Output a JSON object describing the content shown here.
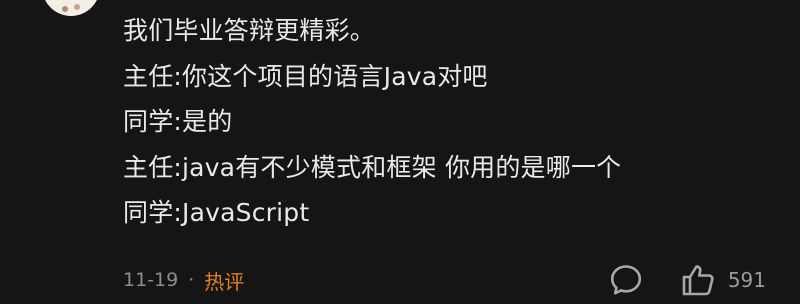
{
  "comment": {
    "lines": [
      "我们毕业答辩更精彩。",
      "主任:你这个项目的语言Java对吧",
      "同学:是的",
      "主任:java有不少模式和框架 你用的是哪一个",
      "同学:JavaScript"
    ],
    "date": "11-19",
    "separator": "·",
    "tag": "热评",
    "like_count": "591"
  },
  "icons": {
    "reply": "comment-bubble-icon",
    "like": "thumbs-up-icon"
  },
  "colors": {
    "background": "#151515",
    "text": "#e9e9e9",
    "meta": "#8d8d8d",
    "hot_tag": "#e67e22"
  }
}
